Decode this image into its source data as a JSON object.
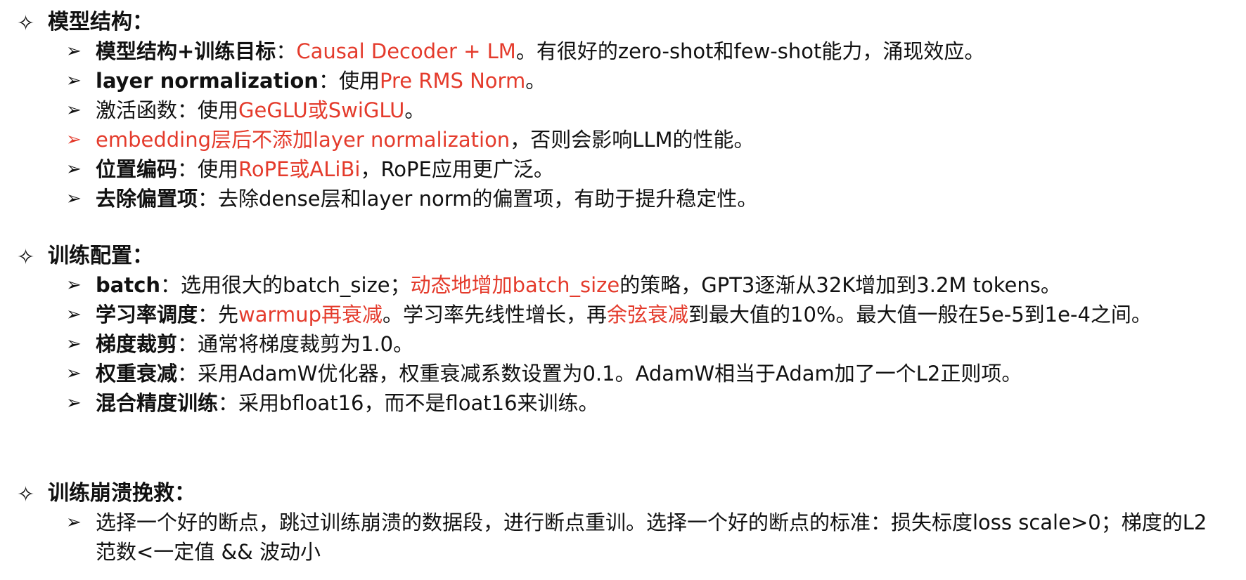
{
  "colors": {
    "text": "#111111",
    "highlight": "#e43b2c"
  },
  "icons": {
    "heading_marker": "four-point-star-icon",
    "item_marker": "arrowhead-bullet-icon"
  },
  "sections": [
    {
      "heading": "模型结构：",
      "items": [
        {
          "segments": [
            {
              "text": "模型结构+训练目标",
              "bold": true
            },
            {
              "text": "："
            },
            {
              "text": "Causal Decoder + LM",
              "red": true
            },
            {
              "text": "。有很好的zero-shot和few-shot能力，涌现效应。"
            }
          ]
        },
        {
          "segments": [
            {
              "text": "layer normalization",
              "bold": true
            },
            {
              "text": "：使用"
            },
            {
              "text": "Pre RMS Norm",
              "red": true
            },
            {
              "text": "。"
            }
          ]
        },
        {
          "segments": [
            {
              "text": "激活函数：使用"
            },
            {
              "text": "GeGLU或SwiGLU",
              "red": true
            },
            {
              "text": "。"
            }
          ]
        },
        {
          "marker_red": true,
          "segments": [
            {
              "text": "embedding层后不添加layer normalization",
              "red": true
            },
            {
              "text": "，否则会影响LLM的性能。"
            }
          ]
        },
        {
          "segments": [
            {
              "text": "位置编码",
              "bold": true
            },
            {
              "text": "：使用"
            },
            {
              "text": "RoPE或ALiBi",
              "red": true
            },
            {
              "text": "，RoPE应用更广泛。"
            }
          ]
        },
        {
          "segments": [
            {
              "text": "去除偏置项",
              "bold": true
            },
            {
              "text": "：去除dense层和layer norm的偏置项，有助于提升稳定性。"
            }
          ]
        }
      ]
    },
    {
      "heading": "训练配置：",
      "items": [
        {
          "segments": [
            {
              "text": "batch",
              "bold": true
            },
            {
              "text": "：选用很大的batch_size；"
            },
            {
              "text": "动态地增加batch_size",
              "red": true
            },
            {
              "text": "的策略，GPT3逐渐从32K增加到3.2M tokens。"
            }
          ]
        },
        {
          "wrap": true,
          "segments": [
            {
              "text": "学习率调度",
              "bold": true
            },
            {
              "text": "：先"
            },
            {
              "text": "warmup再衰减",
              "red": true
            },
            {
              "text": "。学习率先线性增长，再"
            },
            {
              "text": "余弦衰减",
              "red": true
            },
            {
              "text": "到最大值的10%。最大值一般在5e-5到1e-4之间。"
            }
          ]
        },
        {
          "segments": [
            {
              "text": "梯度裁剪",
              "bold": true
            },
            {
              "text": "：通常将梯度裁剪为1.0。"
            }
          ]
        },
        {
          "segments": [
            {
              "text": "权重衰减",
              "bold": true
            },
            {
              "text": "：采用AdamW优化器，权重衰减系数设置为0.1。AdamW相当于Adam加了一个L2正则项。"
            }
          ]
        },
        {
          "segments": [
            {
              "text": "混合精度训练",
              "bold": true
            },
            {
              "text": "：采用bfloat16，而不是float16来训练。"
            }
          ]
        }
      ]
    },
    {
      "heading": "训练崩溃挽救：",
      "items": [
        {
          "wrap": true,
          "segments": [
            {
              "text": "选择一个好的断点，跳过训练崩溃的数据段，进行断点重训。选择一个好的断点的标准：损失标度loss scale>0；梯度的L2范数<一定值 && 波动小"
            }
          ]
        }
      ]
    }
  ]
}
